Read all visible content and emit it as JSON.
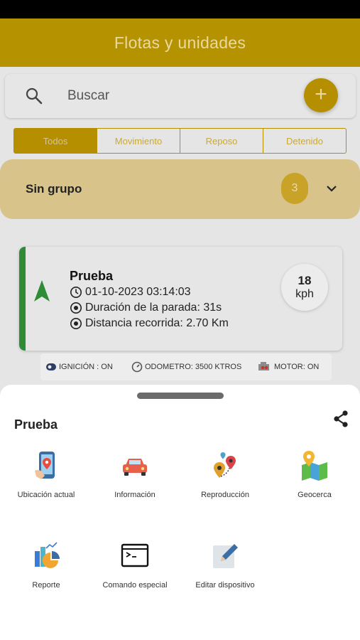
{
  "header": {
    "title": "Flotas y unidades"
  },
  "search": {
    "placeholder": "Buscar"
  },
  "filters": [
    "Todos",
    "Movimiento",
    "Reposo",
    "Detenido"
  ],
  "group": {
    "name": "Sin grupo",
    "count": "3"
  },
  "unit": {
    "name": "Prueba",
    "datetime": "01-10-2023 03:14:03",
    "stop_duration": "Duración de la parada: 31s",
    "distance": "Distancia recorrida: 2.70 Km",
    "speed_value": "18",
    "speed_unit": "kph",
    "ignition": "IGNICIÓN : ON",
    "odometer": "ODOMETRO: 3500 KTROS",
    "motor": "MOTOR: ON",
    "status_color": "#2e8b36"
  },
  "sheet": {
    "title": "Prueba",
    "actions": [
      {
        "label": "Ubicación actual",
        "icon": "phone-location-icon"
      },
      {
        "label": "Información",
        "icon": "car-icon"
      },
      {
        "label": "Reproducción",
        "icon": "route-pins-icon"
      },
      {
        "label": "Geocerca",
        "icon": "map-pin-icon"
      },
      {
        "label": "Reporte",
        "icon": "report-chart-icon"
      },
      {
        "label": "Comando especial",
        "icon": "terminal-icon"
      },
      {
        "label": "Editar dispositivo",
        "icon": "edit-pencil-icon"
      }
    ]
  },
  "colors": {
    "accent": "#b58f00",
    "header": "#b59200",
    "group_bg": "#d8c48b"
  }
}
